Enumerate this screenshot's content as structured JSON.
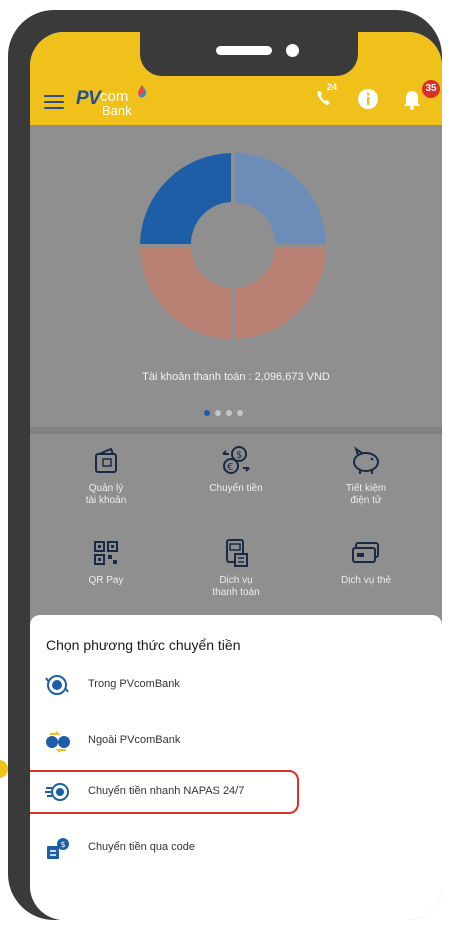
{
  "appbar": {
    "logo_pv": "PV",
    "logo_com": "com",
    "logo_bank": "Bank",
    "hotline_badge": "24",
    "notification_count": "35"
  },
  "dashboard": {
    "balance_text": "Tài khoản thanh toán : 2,096,673 VND",
    "carousel_total": 4,
    "carousel_active": 1
  },
  "menu": [
    {
      "label_line1": "Quản lý",
      "label_line2": "tài khoản",
      "icon": "wallet-icon"
    },
    {
      "label_line1": "Chuyển tiền",
      "label_line2": "",
      "icon": "currency-exchange-icon"
    },
    {
      "label_line1": "Tiết kiệm",
      "label_line2": "điện tử",
      "icon": "piggy-bank-icon"
    },
    {
      "label_line1": "QR Pay",
      "label_line2": "",
      "icon": "qr-code-icon"
    },
    {
      "label_line1": "Dịch vụ",
      "label_line2": "thanh toán",
      "icon": "bill-payment-icon"
    },
    {
      "label_line1": "Dịch vụ thẻ",
      "label_line2": "",
      "icon": "card-icon"
    }
  ],
  "sheet": {
    "title": "Chọn phương thức chuyển tiền",
    "options": [
      {
        "label": "Trong PVcomBank",
        "icon": "internal-transfer-icon"
      },
      {
        "label": "Ngoài PVcomBank",
        "icon": "external-transfer-icon"
      },
      {
        "label": "Chuyển tiền nhanh NAPAS 24/7",
        "icon": "fast-transfer-icon",
        "highlighted": true
      },
      {
        "label": "Chuyển tiền qua code",
        "icon": "code-transfer-icon"
      }
    ]
  },
  "colors": {
    "brand_yellow": "#f0c11a",
    "brand_blue": "#1d5ea6",
    "highlight_red": "#d9302a"
  }
}
